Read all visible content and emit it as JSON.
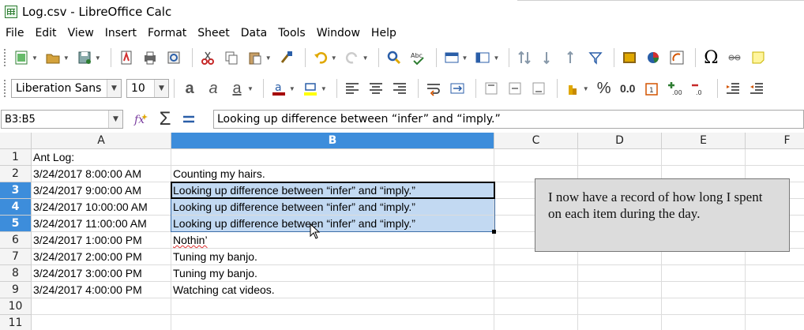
{
  "window": {
    "title": "Log.csv - LibreOffice Calc"
  },
  "menu": [
    "File",
    "Edit",
    "View",
    "Insert",
    "Format",
    "Sheet",
    "Data",
    "Tools",
    "Window",
    "Help"
  ],
  "format_toolbar": {
    "font_name": "Liberation Sans",
    "font_size": "10"
  },
  "formula_bar": {
    "name_box": "B3:B5",
    "content": "Looking up difference between “infer” and “imply.”"
  },
  "columns": [
    "A",
    "B",
    "C",
    "D",
    "E",
    "F"
  ],
  "selected_column": "B",
  "rows": [
    {
      "num": "1",
      "a": "Ant Log:",
      "b": ""
    },
    {
      "num": "2",
      "a": "3/24/2017 8:00:00 AM",
      "b": "Counting my hairs."
    },
    {
      "num": "3",
      "a": "3/24/2017 9:00:00 AM",
      "b": "Looking up difference between “infer” and “imply.”"
    },
    {
      "num": "4",
      "a": "3/24/2017 10:00:00 AM",
      "b": "Looking up difference between “infer” and “imply.”"
    },
    {
      "num": "5",
      "a": "3/24/2017 11:00:00 AM",
      "b": "Looking up difference between “infer” and “imply.”"
    },
    {
      "num": "6",
      "a": "3/24/2017 1:00:00 PM",
      "b": "Nothin’"
    },
    {
      "num": "7",
      "a": "3/24/2017 2:00:00 PM",
      "b": "Tuning my banjo."
    },
    {
      "num": "8",
      "a": "3/24/2017 3:00:00 PM",
      "b": "Tuning my banjo."
    },
    {
      "num": "9",
      "a": "3/24/2017 4:00:00 PM",
      "b": "Watching cat videos."
    },
    {
      "num": "10",
      "a": "",
      "b": ""
    },
    {
      "num": "11",
      "a": "",
      "b": ""
    }
  ],
  "selected_rows": [
    "3",
    "4",
    "5"
  ],
  "note": "I now have a record of how long I spent on each item during the day.",
  "colors": {
    "selection_header": "#3d8ddb",
    "selection_fill": "#c2d9f2",
    "note_bg": "#dcdcdc"
  },
  "icons": {
    "toolbar1": [
      "new-document-icon",
      "open-folder-icon",
      "save-icon",
      "export-pdf-icon",
      "print-icon",
      "print-preview-icon",
      "cut-icon",
      "copy-icon",
      "paste-icon",
      "clone-formatting-icon",
      "undo-icon",
      "redo-icon",
      "find-replace-icon",
      "spellcheck-icon",
      "row-icon",
      "column-icon",
      "sort-icon",
      "sort-ascending-icon",
      "sort-descending-icon",
      "autofilter-icon",
      "image-icon",
      "chart-icon",
      "pivot-table-icon",
      "special-character-icon",
      "hyperlink-icon",
      "comment-icon"
    ],
    "toolbar2": [
      "bold-icon",
      "italic-icon",
      "underline-icon",
      "font-color-icon",
      "highlight-icon",
      "align-left-icon",
      "align-center-icon",
      "align-right-icon",
      "wrap-text-icon",
      "merge-cells-icon",
      "align-top-icon",
      "align-middle-icon",
      "align-bottom-icon",
      "currency-icon",
      "percent-icon",
      "number-format-icon",
      "date-format-icon",
      "add-decimal-icon",
      "delete-decimal-icon",
      "increase-indent-icon",
      "decrease-indent-icon"
    ]
  }
}
